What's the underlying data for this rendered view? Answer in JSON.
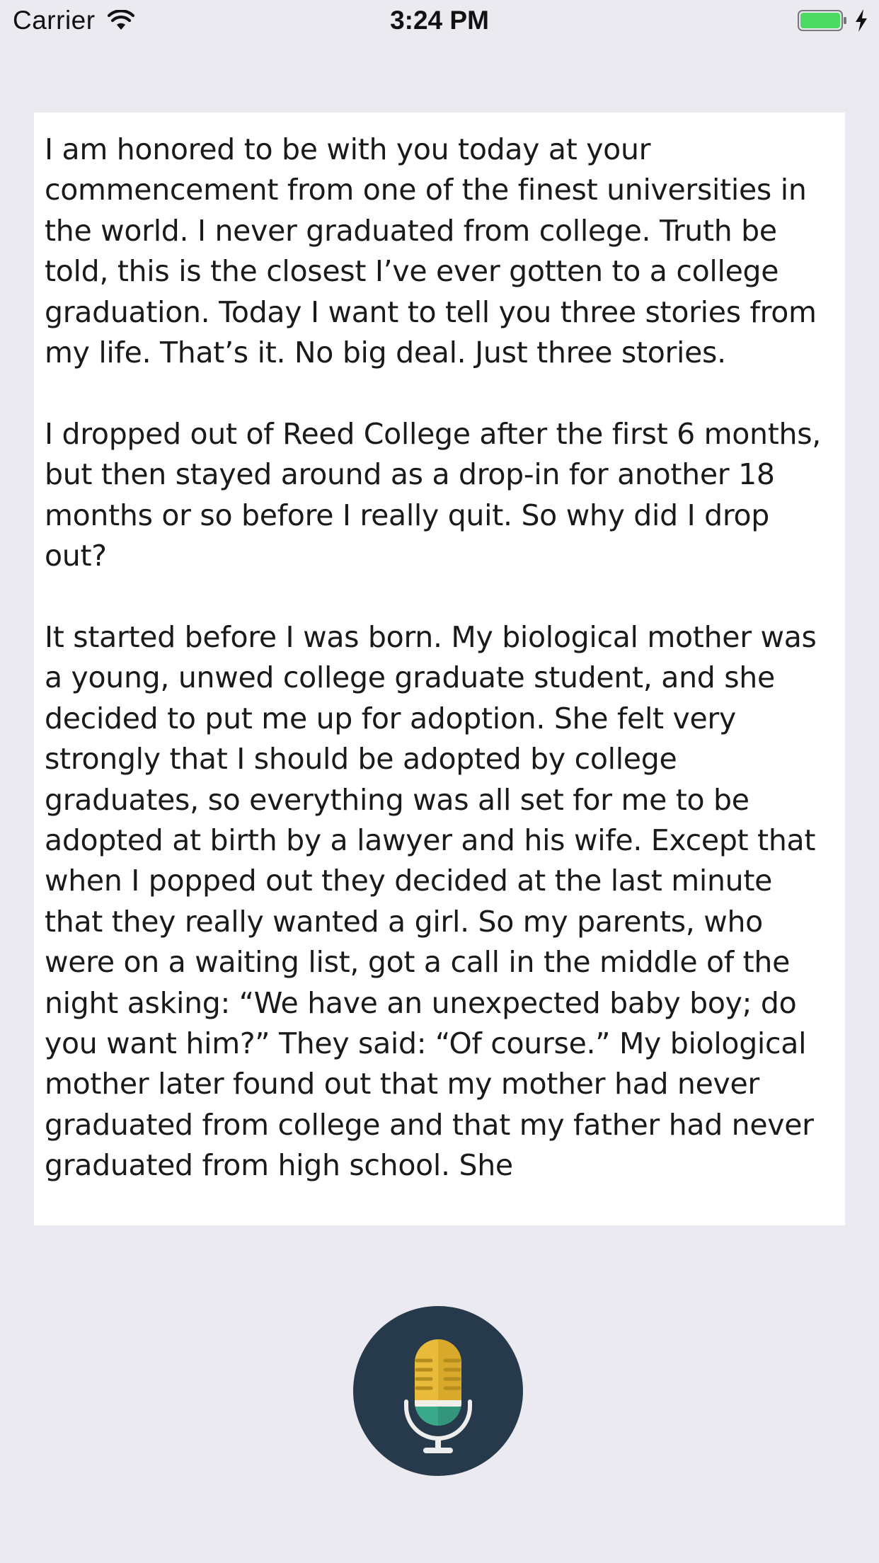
{
  "status_bar": {
    "carrier": "Carrier",
    "time": "3:24 PM",
    "battery_color": "#4cd964",
    "icons": [
      "wifi-icon",
      "battery-icon",
      "charging-bolt-icon"
    ]
  },
  "content": {
    "text": "I am honored to be with you today at your commencement from one of the finest universities in the world. I never graduated from college. Truth be told, this is the closest I’ve ever gotten to a college graduation. Today I want to tell you three stories from my life. That’s it. No big deal. Just three stories.\n\nI dropped out of Reed College after the first 6 months, but then stayed around as a drop-in for another 18 months or so before I really quit. So why did I drop out?\n\nIt started before I was born. My biological mother was a young, unwed college graduate student, and she decided to put me up for adoption. She felt very strongly that I should be adopted by college graduates, so everything was all set for me to be adopted at birth by a lawyer and his wife. Except that when I popped out they decided at the last minute that they really wanted a girl. So my parents, who were on a waiting list, got a call in the middle of the night asking: “We have an unexpected baby boy; do you want him?” They said: “Of course.” My biological mother later found out that my mother had never graduated from college and that my father had never graduated from high school. She"
  },
  "record_button": {
    "icon": "microphone-icon",
    "background_color": "#263a4b",
    "mic_head_color": "#e8bb3a",
    "mic_base_color": "#3aa98a"
  }
}
